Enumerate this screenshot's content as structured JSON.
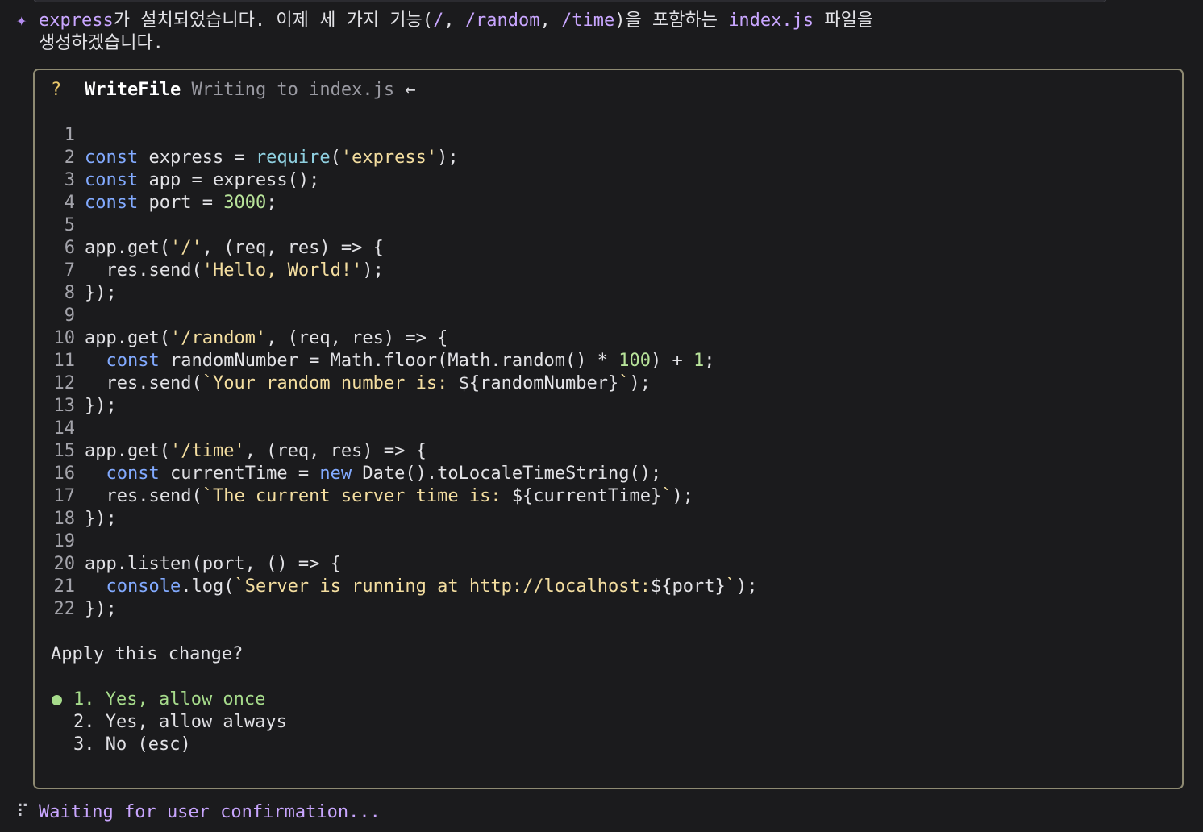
{
  "message": {
    "icon": "sparkle-icon",
    "line1": [
      {
        "t": "express",
        "c": "hl"
      },
      {
        "t": "가 설치되었습니다. 이제 세 가지 기능(",
        "c": "plain"
      },
      {
        "t": "/",
        "c": "hl"
      },
      {
        "t": ", ",
        "c": "plain"
      },
      {
        "t": "/random",
        "c": "hl"
      },
      {
        "t": ", ",
        "c": "plain"
      },
      {
        "t": "/time",
        "c": "hl"
      },
      {
        "t": ")을 포함하는 ",
        "c": "plain"
      },
      {
        "t": "index.js",
        "c": "hl"
      },
      {
        "t": " 파일을",
        "c": "plain"
      }
    ],
    "line2": "생성하겠습니다."
  },
  "panel": {
    "status_icon": "?",
    "tool_name": "WriteFile",
    "description": "Writing to index.js",
    "arrow": "←"
  },
  "code_lines": [
    [],
    [
      {
        "t": "const",
        "c": "kw"
      },
      {
        "t": " express = "
      },
      {
        "t": "require",
        "c": "fn"
      },
      {
        "t": "("
      },
      {
        "t": "'express'",
        "c": "str"
      },
      {
        "t": ");"
      }
    ],
    [
      {
        "t": "const",
        "c": "kw"
      },
      {
        "t": " app = express();"
      }
    ],
    [
      {
        "t": "const",
        "c": "kw"
      },
      {
        "t": " port = "
      },
      {
        "t": "3000",
        "c": "num"
      },
      {
        "t": ";"
      }
    ],
    [],
    [
      {
        "t": "app.get("
      },
      {
        "t": "'/'",
        "c": "str"
      },
      {
        "t": ", (req, res) => {"
      }
    ],
    [
      {
        "t": "  res.send("
      },
      {
        "t": "'Hello, World!'",
        "c": "str"
      },
      {
        "t": ");"
      }
    ],
    [
      {
        "t": "});"
      }
    ],
    [],
    [
      {
        "t": "app.get("
      },
      {
        "t": "'/random'",
        "c": "str"
      },
      {
        "t": ", (req, res) => {"
      }
    ],
    [
      {
        "t": "  "
      },
      {
        "t": "const",
        "c": "kw"
      },
      {
        "t": " randomNumber = Math.floor(Math.random() * "
      },
      {
        "t": "100",
        "c": "num"
      },
      {
        "t": ") + "
      },
      {
        "t": "1",
        "c": "num"
      },
      {
        "t": ";"
      }
    ],
    [
      {
        "t": "  res.send("
      },
      {
        "t": "`Your random number is: ",
        "c": "str"
      },
      {
        "t": "${randomNumber}"
      },
      {
        "t": "`",
        "c": "str"
      },
      {
        "t": ");"
      }
    ],
    [
      {
        "t": "});"
      }
    ],
    [],
    [
      {
        "t": "app.get("
      },
      {
        "t": "'/time'",
        "c": "str"
      },
      {
        "t": ", (req, res) => {"
      }
    ],
    [
      {
        "t": "  "
      },
      {
        "t": "const",
        "c": "kw"
      },
      {
        "t": " currentTime = "
      },
      {
        "t": "new",
        "c": "kw"
      },
      {
        "t": " Date().toLocaleTimeString();"
      }
    ],
    [
      {
        "t": "  res.send("
      },
      {
        "t": "`The current server time is: ",
        "c": "str"
      },
      {
        "t": "${currentTime}"
      },
      {
        "t": "`",
        "c": "str"
      },
      {
        "t": ");"
      }
    ],
    [
      {
        "t": "});"
      }
    ],
    [],
    [
      {
        "t": "app.listen(port, () => {"
      }
    ],
    [
      {
        "t": "  "
      },
      {
        "t": "console",
        "c": "kw"
      },
      {
        "t": ".log("
      },
      {
        "t": "`Server is running at http://localhost:",
        "c": "str"
      },
      {
        "t": "${port}"
      },
      {
        "t": "`",
        "c": "str"
      },
      {
        "t": ");"
      }
    ],
    [
      {
        "t": "});"
      }
    ]
  ],
  "question": "Apply this change?",
  "options": [
    {
      "label": "1. Yes, allow once",
      "selected": true
    },
    {
      "label": "2. Yes, allow always",
      "selected": false
    },
    {
      "label": "3. No (esc)",
      "selected": false
    }
  ],
  "status": {
    "icon": "spinner-icon",
    "text": "Waiting for user confirmation..."
  }
}
